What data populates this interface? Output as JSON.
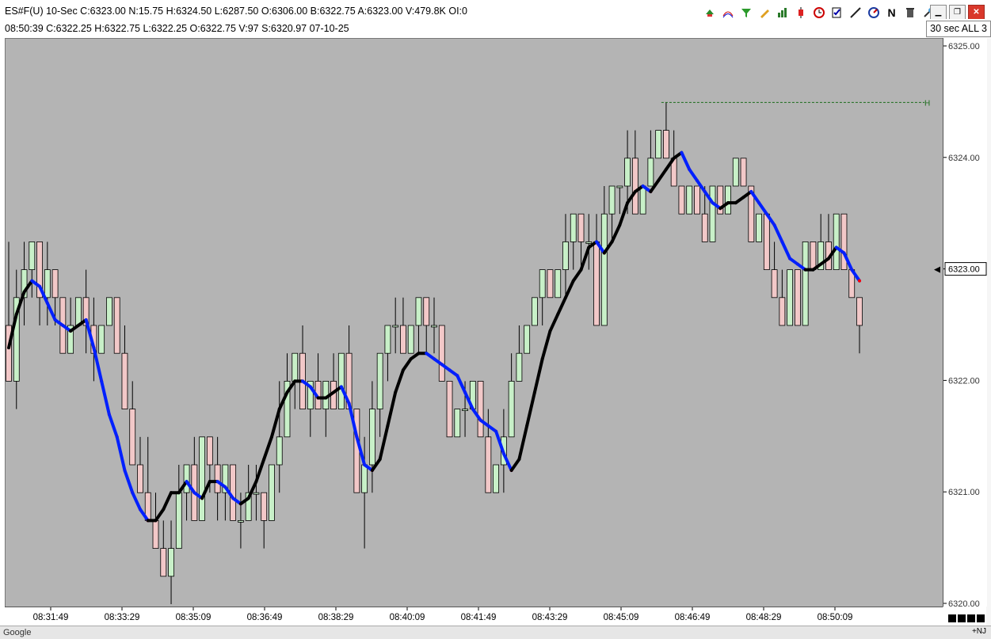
{
  "header": {
    "line1": "ES#F(U)  10-Sec  C:6323.00  N:15.75  H:6324.50  L:6287.50  O:6306.00  B:6322.75  A:6323.00  V:479.8K  OI:0",
    "line2": "08:50:39  C:6322.25   H:6322.75   L:6322.25   O:6322.75   V:97   S:6320.97   07-10-25",
    "period_button": "30 sec ALL 3"
  },
  "toolbar": [
    "cursor-icon",
    "curves-icon",
    "funnel-icon",
    "pencil-icon",
    "bars-icon",
    "candle-icon",
    "clock-icon",
    "checklist-icon",
    "draw-line-icon",
    "compass-icon",
    "N",
    "trash-icon",
    "tools-icon"
  ],
  "window_buttons": {
    "minimize": "▁",
    "restore": "❐",
    "close": "✕"
  },
  "bottom_tabs": "Google",
  "bottom_right": "+NJ",
  "colors": {
    "plot_bg": "#b4b4b4",
    "up_bar": "#c8f0c8",
    "down_bar": "#f2c8c8",
    "bar_outline": "#000000",
    "ma_up": "#000000",
    "ma_down": "#0020ff",
    "ma_dot": "#ff0000",
    "high_line": "#1a6b1a"
  },
  "chart_data": {
    "type": "candlestick",
    "title": "",
    "xlabel": "",
    "ylabel": "",
    "ylim": [
      6320.0,
      6325.0
    ],
    "yticks": [
      6320.0,
      6321.0,
      6322.0,
      6323.0,
      6324.0,
      6325.0
    ],
    "x_tick_labels": [
      "08:31:49",
      "08:33:29",
      "08:35:09",
      "08:36:49",
      "08:38:29",
      "08:40:09",
      "08:41:49",
      "08:43:29",
      "08:45:09",
      "08:46:49",
      "08:48:29",
      "08:50:09"
    ],
    "last_price_label": "6323.00",
    "high_marker": {
      "price": 6324.5,
      "label": "H"
    },
    "ohlc": [
      [
        6322.5,
        6323.25,
        6322.0,
        6322.0
      ],
      [
        6322.0,
        6323.0,
        6321.75,
        6322.75
      ],
      [
        6322.75,
        6323.25,
        6322.5,
        6323.0
      ],
      [
        6323.0,
        6323.25,
        6322.75,
        6323.25
      ],
      [
        6323.25,
        6323.25,
        6322.5,
        6322.75
      ],
      [
        6322.75,
        6323.25,
        6322.5,
        6323.0
      ],
      [
        6323.0,
        6323.0,
        6322.5,
        6322.75
      ],
      [
        6322.75,
        6322.75,
        6322.25,
        6322.25
      ],
      [
        6322.25,
        6322.75,
        6322.25,
        6322.5
      ],
      [
        6322.5,
        6322.75,
        6322.5,
        6322.75
      ],
      [
        6322.75,
        6323.0,
        6322.25,
        6322.5
      ],
      [
        6322.5,
        6322.75,
        6322.0,
        6322.25
      ],
      [
        6322.25,
        6322.5,
        6322.25,
        6322.5
      ],
      [
        6322.5,
        6322.75,
        6322.5,
        6322.75
      ],
      [
        6322.75,
        6322.75,
        6322.25,
        6322.25
      ],
      [
        6322.25,
        6322.5,
        6321.75,
        6321.75
      ],
      [
        6321.75,
        6322.0,
        6321.25,
        6321.25
      ],
      [
        6321.25,
        6321.5,
        6321.0,
        6321.0
      ],
      [
        6321.0,
        6321.5,
        6320.75,
        6320.75
      ],
      [
        6320.75,
        6321.0,
        6320.5,
        6320.5
      ],
      [
        6320.5,
        6320.75,
        6320.25,
        6320.25
      ],
      [
        6320.25,
        6320.75,
        6320.0,
        6320.5
      ],
      [
        6320.5,
        6321.25,
        6320.5,
        6321.0
      ],
      [
        6321.0,
        6321.25,
        6320.75,
        6321.25
      ],
      [
        6321.25,
        6321.5,
        6320.75,
        6320.75
      ],
      [
        6320.75,
        6321.5,
        6320.75,
        6321.5
      ],
      [
        6321.5,
        6321.5,
        6321.0,
        6321.25
      ],
      [
        6321.25,
        6321.5,
        6320.75,
        6321.0
      ],
      [
        6321.0,
        6321.25,
        6320.75,
        6321.25
      ],
      [
        6321.25,
        6321.25,
        6320.75,
        6320.75
      ],
      [
        6320.75,
        6321.0,
        6320.5,
        6320.75
      ],
      [
        6320.75,
        6321.25,
        6320.75,
        6321.0
      ],
      [
        6321.0,
        6321.25,
        6320.75,
        6321.0
      ],
      [
        6321.0,
        6321.0,
        6320.5,
        6320.75
      ],
      [
        6320.75,
        6321.25,
        6320.75,
        6321.25
      ],
      [
        6321.25,
        6322.0,
        6321.0,
        6321.5
      ],
      [
        6321.5,
        6322.25,
        6321.5,
        6322.0
      ],
      [
        6322.0,
        6322.25,
        6321.75,
        6322.25
      ],
      [
        6322.25,
        6322.5,
        6321.75,
        6321.75
      ],
      [
        6321.75,
        6322.0,
        6321.5,
        6322.0
      ],
      [
        6322.0,
        6322.25,
        6321.75,
        6321.75
      ],
      [
        6321.75,
        6322.0,
        6321.5,
        6322.0
      ],
      [
        6322.0,
        6322.25,
        6321.75,
        6321.75
      ],
      [
        6321.75,
        6322.25,
        6321.75,
        6322.25
      ],
      [
        6322.25,
        6322.5,
        6321.75,
        6321.75
      ],
      [
        6321.75,
        6321.75,
        6321.0,
        6321.0
      ],
      [
        6321.0,
        6321.5,
        6320.5,
        6321.25
      ],
      [
        6321.25,
        6322.0,
        6321.0,
        6321.75
      ],
      [
        6321.75,
        6322.25,
        6321.5,
        6322.25
      ],
      [
        6322.25,
        6322.5,
        6322.0,
        6322.5
      ],
      [
        6322.5,
        6322.75,
        6322.25,
        6322.5
      ],
      [
        6322.5,
        6322.75,
        6322.25,
        6322.25
      ],
      [
        6322.25,
        6322.5,
        6322.25,
        6322.5
      ],
      [
        6322.5,
        6322.75,
        6322.25,
        6322.75
      ],
      [
        6322.75,
        6322.75,
        6322.25,
        6322.5
      ],
      [
        6322.5,
        6322.75,
        6322.25,
        6322.5
      ],
      [
        6322.5,
        6322.5,
        6322.0,
        6322.0
      ],
      [
        6322.0,
        6322.0,
        6321.5,
        6321.5
      ],
      [
        6321.5,
        6321.75,
        6321.5,
        6321.75
      ],
      [
        6321.75,
        6322.0,
        6321.5,
        6321.75
      ],
      [
        6321.75,
        6322.0,
        6321.75,
        6322.0
      ],
      [
        6322.0,
        6322.0,
        6321.5,
        6321.5
      ],
      [
        6321.5,
        6321.75,
        6321.0,
        6321.0
      ],
      [
        6321.0,
        6321.25,
        6321.0,
        6321.25
      ],
      [
        6321.25,
        6321.75,
        6321.0,
        6321.5
      ],
      [
        6321.5,
        6322.25,
        6321.5,
        6322.0
      ],
      [
        6322.0,
        6322.5,
        6322.0,
        6322.25
      ],
      [
        6322.25,
        6322.5,
        6322.25,
        6322.5
      ],
      [
        6322.5,
        6322.75,
        6322.5,
        6322.75
      ],
      [
        6322.75,
        6323.0,
        6322.5,
        6323.0
      ],
      [
        6323.0,
        6323.0,
        6322.75,
        6322.75
      ],
      [
        6322.75,
        6323.0,
        6322.75,
        6323.0
      ],
      [
        6323.0,
        6323.5,
        6322.75,
        6323.25
      ],
      [
        6323.25,
        6323.5,
        6323.0,
        6323.5
      ],
      [
        6323.5,
        6323.5,
        6323.0,
        6323.25
      ],
      [
        6323.25,
        6323.5,
        6323.0,
        6323.25
      ],
      [
        6323.25,
        6323.5,
        6322.5,
        6322.5
      ],
      [
        6322.5,
        6323.75,
        6322.5,
        6323.5
      ],
      [
        6323.5,
        6323.75,
        6323.25,
        6323.75
      ],
      [
        6323.75,
        6323.75,
        6323.5,
        6323.75
      ],
      [
        6323.75,
        6324.25,
        6323.5,
        6324.0
      ],
      [
        6324.0,
        6324.25,
        6323.5,
        6323.5
      ],
      [
        6323.5,
        6323.75,
        6323.5,
        6323.75
      ],
      [
        6323.75,
        6324.25,
        6323.75,
        6324.0
      ],
      [
        6324.0,
        6324.25,
        6324.0,
        6324.25
      ],
      [
        6324.25,
        6324.5,
        6324.0,
        6324.0
      ],
      [
        6324.0,
        6324.25,
        6323.75,
        6323.75
      ],
      [
        6323.75,
        6323.75,
        6323.5,
        6323.5
      ],
      [
        6323.5,
        6323.75,
        6323.5,
        6323.75
      ],
      [
        6323.75,
        6323.75,
        6323.5,
        6323.5
      ],
      [
        6323.5,
        6323.75,
        6323.25,
        6323.25
      ],
      [
        6323.25,
        6323.75,
        6323.25,
        6323.75
      ],
      [
        6323.75,
        6323.75,
        6323.5,
        6323.5
      ],
      [
        6323.5,
        6323.75,
        6323.5,
        6323.75
      ],
      [
        6323.75,
        6324.0,
        6323.75,
        6324.0
      ],
      [
        6324.0,
        6324.0,
        6323.75,
        6323.75
      ],
      [
        6323.75,
        6323.75,
        6323.25,
        6323.25
      ],
      [
        6323.25,
        6323.5,
        6323.25,
        6323.5
      ],
      [
        6323.5,
        6323.5,
        6323.0,
        6323.0
      ],
      [
        6323.0,
        6323.25,
        6322.75,
        6322.75
      ],
      [
        6322.75,
        6323.0,
        6322.5,
        6322.5
      ],
      [
        6322.5,
        6323.0,
        6322.5,
        6323.0
      ],
      [
        6323.0,
        6323.0,
        6322.5,
        6322.5
      ],
      [
        6322.5,
        6323.25,
        6322.5,
        6323.25
      ],
      [
        6323.25,
        6323.25,
        6323.0,
        6323.0
      ],
      [
        6323.0,
        6323.5,
        6323.0,
        6323.25
      ],
      [
        6323.25,
        6323.5,
        6323.0,
        6323.0
      ],
      [
        6323.0,
        6323.5,
        6323.0,
        6323.5
      ],
      [
        6323.5,
        6323.5,
        6323.0,
        6323.0
      ],
      [
        6323.0,
        6323.0,
        6322.75,
        6322.75
      ],
      [
        6322.75,
        6322.75,
        6322.25,
        6322.5
      ]
    ],
    "moving_average": [
      6322.3,
      6322.6,
      6322.8,
      6322.9,
      6322.85,
      6322.7,
      6322.55,
      6322.5,
      6322.45,
      6322.5,
      6322.55,
      6322.3,
      6322.0,
      6321.7,
      6321.5,
      6321.2,
      6321.0,
      6320.85,
      6320.75,
      6320.75,
      6320.85,
      6321.0,
      6321.0,
      6321.1,
      6321.0,
      6320.95,
      6321.1,
      6321.1,
      6321.05,
      6320.95,
      6320.9,
      6320.95,
      6321.1,
      6321.3,
      6321.5,
      6321.75,
      6321.9,
      6322.0,
      6322.0,
      6321.95,
      6321.85,
      6321.85,
      6321.9,
      6321.95,
      6321.8,
      6321.5,
      6321.25,
      6321.2,
      6321.3,
      6321.6,
      6321.9,
      6322.1,
      6322.2,
      6322.25,
      6322.25,
      6322.2,
      6322.15,
      6322.1,
      6322.05,
      6321.9,
      6321.75,
      6321.65,
      6321.6,
      6321.55,
      6321.35,
      6321.2,
      6321.3,
      6321.6,
      6321.9,
      6322.2,
      6322.45,
      6322.6,
      6322.75,
      6322.9,
      6323.0,
      6323.2,
      6323.25,
      6323.15,
      6323.25,
      6323.4,
      6323.6,
      6323.7,
      6323.75,
      6323.7,
      6323.8,
      6323.9,
      6324.0,
      6324.05,
      6323.9,
      6323.8,
      6323.7,
      6323.6,
      6323.55,
      6323.6,
      6323.6,
      6323.65,
      6323.7,
      6323.6,
      6323.5,
      6323.4,
      6323.25,
      6323.1,
      6323.05,
      6323.0,
      6323.0,
      6323.05,
      6323.1,
      6323.2,
      6323.15,
      6323.0,
      6322.9
    ]
  }
}
